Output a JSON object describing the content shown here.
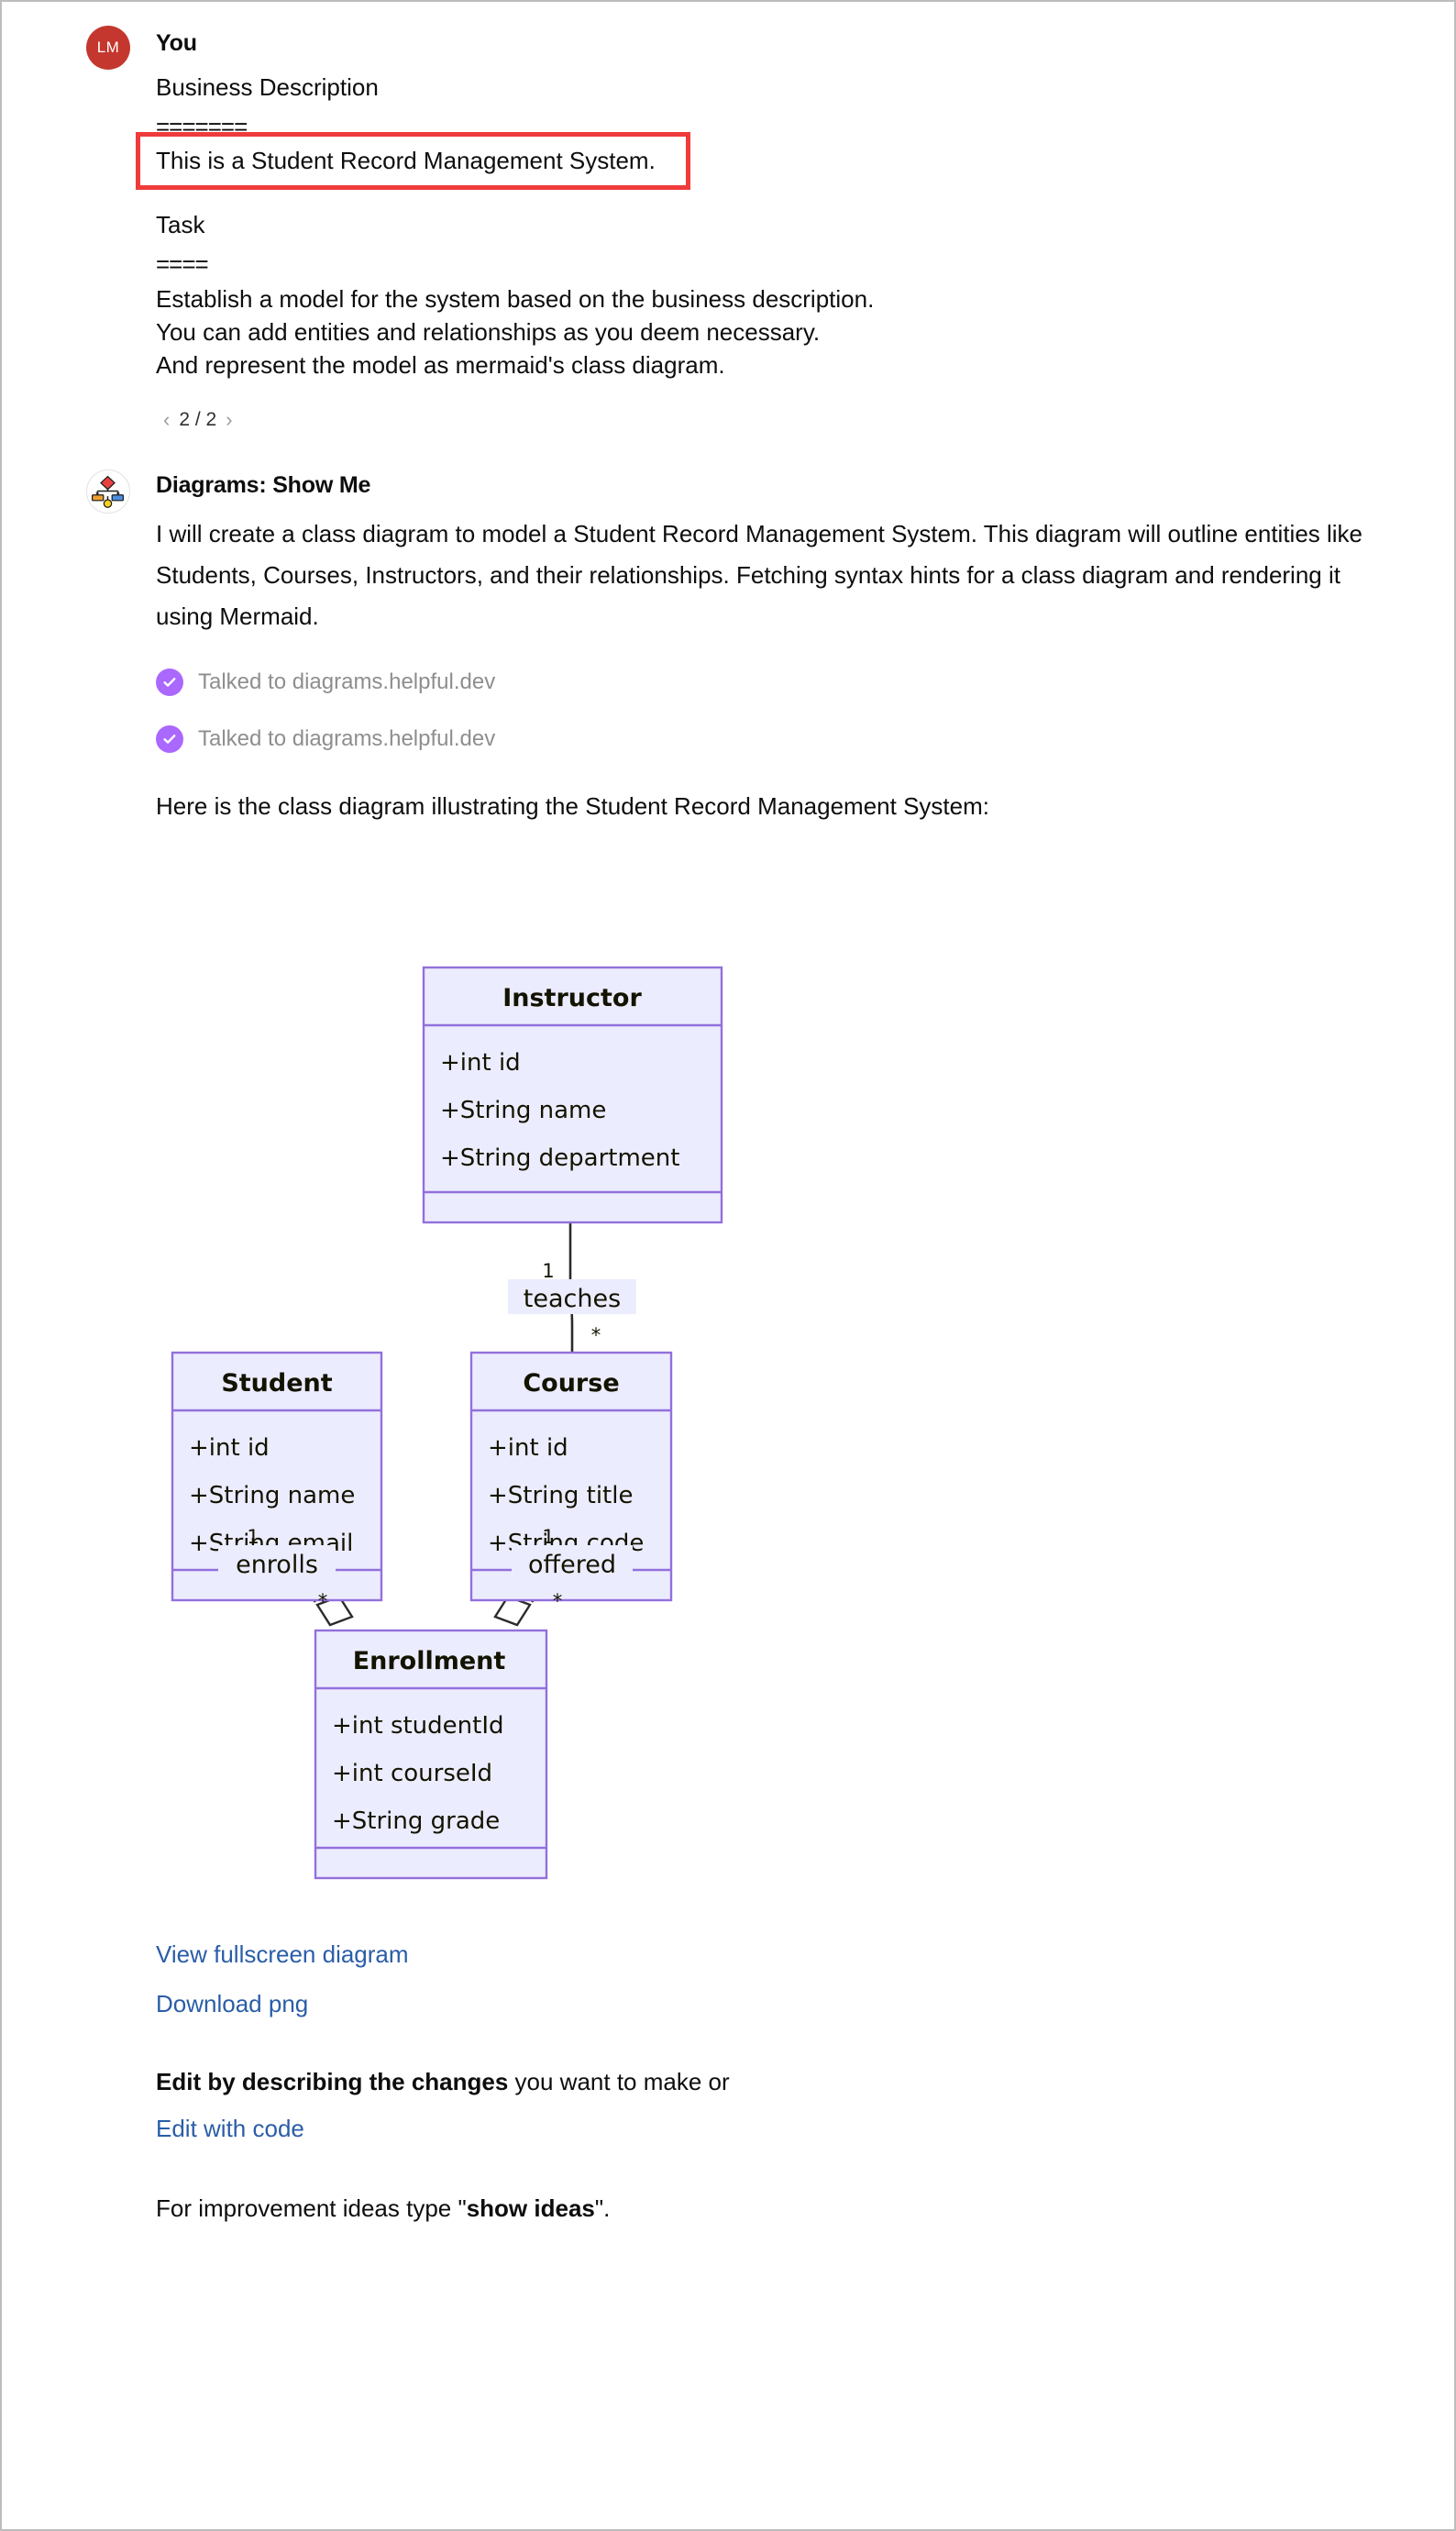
{
  "user_message": {
    "avatar_initials": "LM",
    "avatar_color": "#c4372e",
    "sender": "You",
    "section1_heading": "Business Description",
    "section1_rule": "=======",
    "highlighted_sentence": "This is a Student Record Management System.",
    "highlight_color": "#f03b3b",
    "section2_heading": "Task",
    "section2_rule": "====",
    "task_line1": "Establish a model for the system based on the business description.",
    "task_line2": "You can add entities and relationships as you deem necessary.",
    "task_line3": "And represent the model as mermaid's class diagram.",
    "pagination": {
      "prev_icon": "chevron-left-icon",
      "prev_glyph": "‹",
      "counter": "2 / 2",
      "next_icon": "chevron-right-icon",
      "next_glyph": "›"
    }
  },
  "assistant_message": {
    "avatar_icon": "diagrams-show-me-plugin-icon",
    "sender": "Diagrams: Show Me",
    "intro_paragraph": "I will create a class diagram to model a Student Record Management System. This diagram will outline entities like Students, Courses, Instructors, and their relationships. Fetching syntax hints for a class diagram and rendering it using Mermaid.",
    "tool_calls": [
      {
        "icon": "check-circle-icon",
        "label": "Talked to diagrams.helpful.dev",
        "badge_color": "#ab68ff"
      },
      {
        "icon": "check-circle-icon",
        "label": "Talked to diagrams.helpful.dev",
        "badge_color": "#ab68ff"
      }
    ],
    "lead_in": "Here is the class diagram illustrating the Student Record Management System:",
    "links": [
      {
        "label": "View fullscreen diagram",
        "color": "#2a5da8"
      },
      {
        "label": "Download png",
        "color": "#2a5da8"
      }
    ],
    "edit_prompt_bold": "Edit by describing the changes",
    "edit_prompt_rest": " you want to make or",
    "edit_with_code_link": "Edit with code",
    "ideas_prefix": "For improvement ideas type \"",
    "ideas_bold": "show ideas",
    "ideas_suffix": "\"."
  },
  "chart_data": {
    "type": "diagram",
    "diagram_kind": "mermaid-class-diagram",
    "theme": {
      "node_fill": "#ececff",
      "node_stroke": "#9370db",
      "edge_stroke": "#2b2b2b",
      "text": "#131300"
    },
    "classes": [
      {
        "name": "Instructor",
        "attributes": [
          "+int id",
          "+String name",
          "+String department"
        ],
        "methods": []
      },
      {
        "name": "Student",
        "attributes": [
          "+int id",
          "+String name",
          "+String email"
        ],
        "methods": []
      },
      {
        "name": "Course",
        "attributes": [
          "+int id",
          "+String title",
          "+String code"
        ],
        "methods": []
      },
      {
        "name": "Enrollment",
        "attributes": [
          "+int studentId",
          "+int courseId",
          "+String grade"
        ],
        "methods": []
      }
    ],
    "relationships": [
      {
        "from": "Instructor",
        "to": "Course",
        "label": "teaches",
        "from_cardinality": "1",
        "to_cardinality": "*",
        "marker": "none"
      },
      {
        "from": "Student",
        "to": "Enrollment",
        "label": "enrolls",
        "from_cardinality": "1",
        "to_cardinality": "*",
        "marker": "aggregation-open-diamond"
      },
      {
        "from": "Course",
        "to": "Enrollment",
        "label": "offered",
        "from_cardinality": "1",
        "to_cardinality": "*",
        "marker": "aggregation-open-diamond"
      }
    ]
  }
}
